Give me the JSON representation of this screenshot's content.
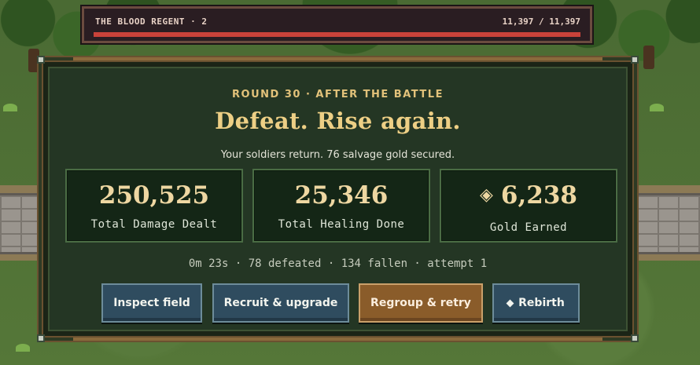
{
  "boss": {
    "name": "THE BLOOD REGENT · 2",
    "hp_text": "11,397 / 11,397",
    "hp_fraction": 1.0
  },
  "result": {
    "round_title": "ROUND 30 · AFTER THE BATTLE",
    "headline": "Defeat. Rise again.",
    "subline": "Your soldiers return. 76 salvage gold secured."
  },
  "stats": [
    {
      "value": "250,525",
      "label": "Total Damage Dealt"
    },
    {
      "value": "25,346",
      "label": "Total Healing Done"
    },
    {
      "value": "6,238",
      "label": "Gold Earned",
      "icon": "diamond-icon"
    }
  ],
  "summary": "0m 23s · 78 defeated · 134 fallen · attempt 1",
  "buttons": {
    "inspect": "Inspect field",
    "recruit": "Recruit & upgrade",
    "retry": "Regroup & retry",
    "rebirth": "Rebirth"
  },
  "colors": {
    "accent_gold": "#edcf85",
    "boss_hp_red": "#c9423a",
    "primary_button": "#8a5c2a",
    "secondary_button": "#2f4c5f"
  }
}
